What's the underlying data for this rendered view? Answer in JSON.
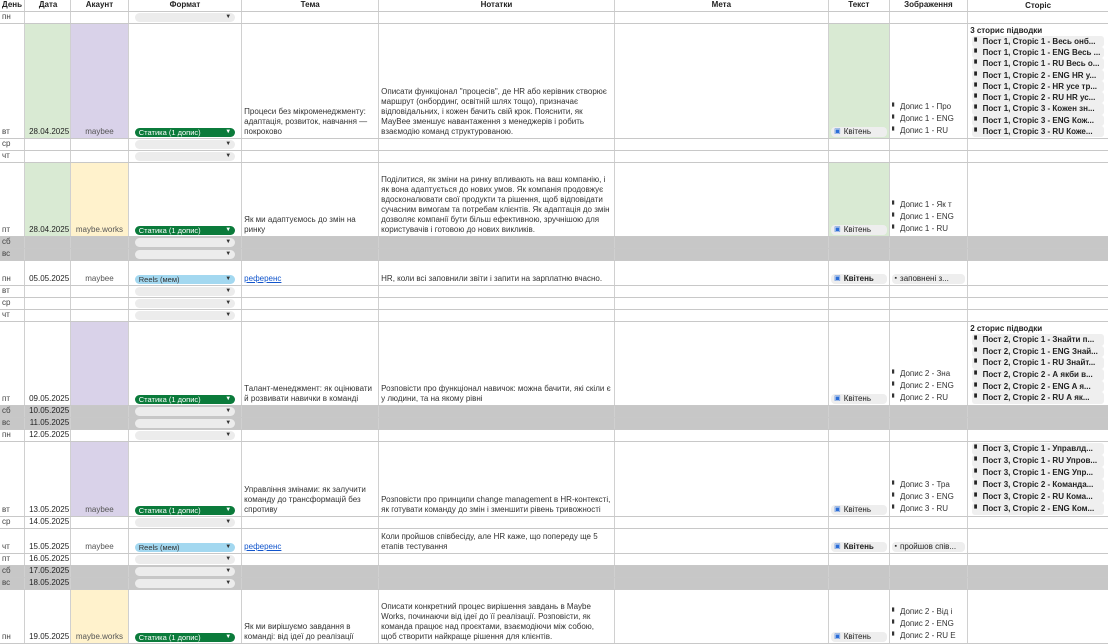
{
  "header": {
    "day": "День",
    "date": "Дата",
    "account": "Акаунт",
    "format": "Формат",
    "topic": "Тема",
    "notes": "Нотатки",
    "meta": "Мета",
    "text": "Текст",
    "image": "Зображення",
    "stories": "Сторіс"
  },
  "colors": {
    "green_cell": "#d9ead3",
    "purple_cell": "#d9d2e9",
    "yellow_cell": "#fff2cc",
    "weekend_row": "#c7c7c7",
    "format_static": "#0b7b3b",
    "format_reels": "#a3d8f0",
    "link": "#1155cc"
  },
  "rows": [
    {
      "day": "пн",
      "date": "",
      "account": "",
      "format": "",
      "topic": "",
      "notes": "",
      "text": "",
      "images": [],
      "stories_head": "",
      "stories": []
    },
    {
      "day": "вт",
      "date": "28.04.2025",
      "date_bg": "green",
      "account": "maybee",
      "account_bg": "purple",
      "format": "Статика (1 допис)",
      "format_style": "green",
      "topic": "Процеси без мікроменеджменту: адаптація, розвиток, навчання — покроково",
      "notes": "Описати функціонал \"процесів\", де HR або керівник створює маршрут (онбординг, освітній шлях тощо), призначає відповідальних, і кожен бачить свій крок. Пояснити, як MayBee зменшує навантаження з менеджерів і робить взаємодію команд структурованою.",
      "text": "Квітень",
      "text_bg": "green",
      "images": [
        "Допис 1 - Про",
        "Допис 1 - ENG",
        "Допис 1 - RU"
      ],
      "stories_head": "3 сторис підводки",
      "stories": [
        "Пост 1, Сторіс 1 - Весь онб...",
        "Пост 1, Сторіс 1 - ENG Весь ...",
        "Пост 1, Сторіс 1 - RU Весь о...",
        "Пост 1, Сторіс 2 - ENG HR у...",
        "Пост 1, Сторіс 2 - HR усе тр...",
        "Пост 1, Сторіс 2 - RU HR ус...",
        "Пост 1, Сторіс 3 - Кожен зн...",
        "Пост 1, Сторіс 3 - ENG Кож...",
        "Пост 1, Сторіс 3 - RU Коже..."
      ]
    },
    {
      "day": "ср",
      "date": "",
      "account": "",
      "format": "",
      "topic": "",
      "notes": "",
      "text": "",
      "images": [],
      "stories_head": "",
      "stories": []
    },
    {
      "day": "чт",
      "date": "",
      "account": "",
      "format": "",
      "topic": "",
      "notes": "",
      "text": "",
      "images": [],
      "stories_head": "",
      "stories": []
    },
    {
      "day": "пт",
      "date": "28.04.2025",
      "date_bg": "green",
      "account": "maybe.works",
      "account_bg": "yellow",
      "format": "Статика (1 допис)",
      "format_style": "green",
      "topic": "Як ми адаптуємось до змін на ринку",
      "notes": "Поділитися, як зміни на ринку впливають на ваш компанію, і як вона адаптується до нових умов. Як компанія продовжує вдосконалювати свої продукти та рішення, щоб відповідати сучасним вимогам та потребам клієнтів. Як адаптація до змін дозволяє компанії бути більш ефективною, зручнішою для користувачів і готовою до нових викликів.",
      "text": "Квітень",
      "text_bg": "green",
      "images": [
        "Допис 1 - Як т",
        "Допис 1 - ENG",
        "Допис 1 - RU"
      ],
      "stories_head": "",
      "stories": []
    },
    {
      "day": "сб",
      "weekend": true,
      "date": "",
      "account": "",
      "format": "",
      "topic": "",
      "notes": "",
      "text": "",
      "images": [],
      "stories_head": "",
      "stories": []
    },
    {
      "day": "вс",
      "weekend": true,
      "date": "",
      "account": "",
      "format": "",
      "topic": "",
      "notes": "",
      "text": "",
      "images": [],
      "stories_head": "",
      "stories": []
    },
    {
      "day": "пн",
      "date": "05.05.2025",
      "account": "maybee",
      "format": "Reels (мем)",
      "format_style": "blue",
      "topic": "референс",
      "topic_link": true,
      "notes": "HR, коли всі заповнили звіти і запити на зарплатню вчасно.",
      "text": "Квітень",
      "text_bold": true,
      "images": [
        "заповнені з..."
      ],
      "image_chip": true,
      "stories_head": "",
      "stories": []
    },
    {
      "day": "вт",
      "date": "",
      "account": "",
      "format": "",
      "topic": "",
      "notes": "",
      "text": "",
      "images": [],
      "stories_head": "",
      "stories": []
    },
    {
      "day": "ср",
      "date": "",
      "account": "",
      "format": "",
      "topic": "",
      "notes": "",
      "text": "",
      "images": [],
      "stories_head": "",
      "stories": []
    },
    {
      "day": "чт",
      "date": "",
      "account": "",
      "format": "",
      "topic": "",
      "notes": "",
      "text": "",
      "images": [],
      "stories_head": "",
      "stories": []
    },
    {
      "day": "пт",
      "date": "09.05.2025",
      "account": "",
      "account_bg": "purple",
      "format": "Статика (1 допис)",
      "format_style": "green",
      "topic": "Талант-менеджмент: як оцінювати й розвивати навички в команді",
      "notes": "Розповісти про функціонал навичок: можна бачити, які скіли є у людини, та на якому рівні",
      "text": "Квітень",
      "images": [
        "Допис 2 - Зна",
        "Допис 2 - ENG",
        "Допис 2 - RU"
      ],
      "stories_head": "2 сторис підводки",
      "stories": [
        "Пост 2, Сторіс 1 - Знайти п...",
        "Пост 2, Сторіс 1 - ENG Знай...",
        "Пост 2, Сторіс 1 - RU Знайт...",
        "Пост 2, Сторіс 2 - А якби в...",
        "Пост 2, Сторіс 2 - ENG A я...",
        "Пост 2, Сторіс 2 - RU А як..."
      ]
    },
    {
      "day": "сб",
      "weekend": true,
      "date": "10.05.2025",
      "account": "",
      "format": "",
      "topic": "",
      "notes": "",
      "text": "",
      "images": [],
      "stories_head": "",
      "stories": []
    },
    {
      "day": "вс",
      "weekend": true,
      "date": "11.05.2025",
      "account": "",
      "format": "",
      "topic": "",
      "notes": "",
      "text": "",
      "images": [],
      "stories_head": "",
      "stories": []
    },
    {
      "day": "пн",
      "date": "12.05.2025",
      "account": "",
      "format": "",
      "topic": "",
      "notes": "",
      "text": "",
      "images": [],
      "stories_head": "",
      "stories": []
    },
    {
      "day": "вт",
      "date": "13.05.2025",
      "account": "maybee",
      "account_bg": "purple",
      "format": "Статика (1 допис)",
      "format_style": "green",
      "topic": "Управління змінами: як залучити команду до трансформацій без спротиву",
      "notes": "Розповісти про принципи change management в HR-контексті, як готувати команду до змін і зменшити рівень тривожності",
      "text": "Квітень",
      "images": [
        "Допис 3 - Тра",
        "Допис 3 - ENG",
        "Допис 3 - RU"
      ],
      "stories_head": "",
      "stories": [
        "Пост 3, Сторіс 1 - Управлд...",
        "Пост 3, Сторіс 1 - RU Упров...",
        "Пост 3, Сторіс 1 - ENG Упр...",
        "Пост 3, Сторіс 2 - Команда...",
        "Пост 3, Сторіс 2 - RU Кома...",
        "Пост 3, Сторіс 2 - ENG Ком..."
      ]
    },
    {
      "day": "ср",
      "date": "14.05.2025",
      "account": "",
      "format": "",
      "topic": "",
      "notes": "",
      "text": "",
      "images": [],
      "stories_head": "",
      "stories": []
    },
    {
      "day": "чт",
      "date": "15.05.2025",
      "account": "maybee",
      "format": "Reels (мем)",
      "format_style": "blue",
      "topic": "референс",
      "topic_link": true,
      "notes": "Коли пройшов співбесіду, але HR каже, що попереду ще 5 етапів тестування",
      "text": "Квітень",
      "text_bold": true,
      "images": [
        "пройшов спів..."
      ],
      "image_chip": true,
      "stories_head": "",
      "stories": []
    },
    {
      "day": "пт",
      "date": "16.05.2025",
      "account": "",
      "format": "",
      "topic": "",
      "notes": "",
      "text": "",
      "images": [],
      "stories_head": "",
      "stories": []
    },
    {
      "day": "сб",
      "weekend": true,
      "date": "17.05.2025",
      "account": "",
      "format": "",
      "topic": "",
      "notes": "",
      "text": "",
      "images": [],
      "stories_head": "",
      "stories": []
    },
    {
      "day": "вс",
      "weekend": true,
      "date": "18.05.2025",
      "account": "",
      "format": "",
      "topic": "",
      "notes": "",
      "text": "",
      "images": [],
      "stories_head": "",
      "stories": []
    },
    {
      "day": "пн",
      "date": "19.05.2025",
      "account": "maybe.works",
      "account_bg": "yellow",
      "format": "Статика (1 допис)",
      "format_style": "green",
      "topic": "Як ми вирішуємо завдання в команді: від ідеї до реалізації",
      "notes": "Описати конкретний процес вирішення завдань в Maybe Works, починаючи від ідеї до її реалізації. Розповісти, як команда працює над проєктами, взаємодіючи між собою, щоб створити найкраще рішення для клієнтів.",
      "text": "Квітень",
      "images": [
        "Допис 2 - Від і",
        "Допис 2 - ENG",
        "Допис 2 - RU E"
      ],
      "stories_head": "",
      "stories": []
    }
  ]
}
